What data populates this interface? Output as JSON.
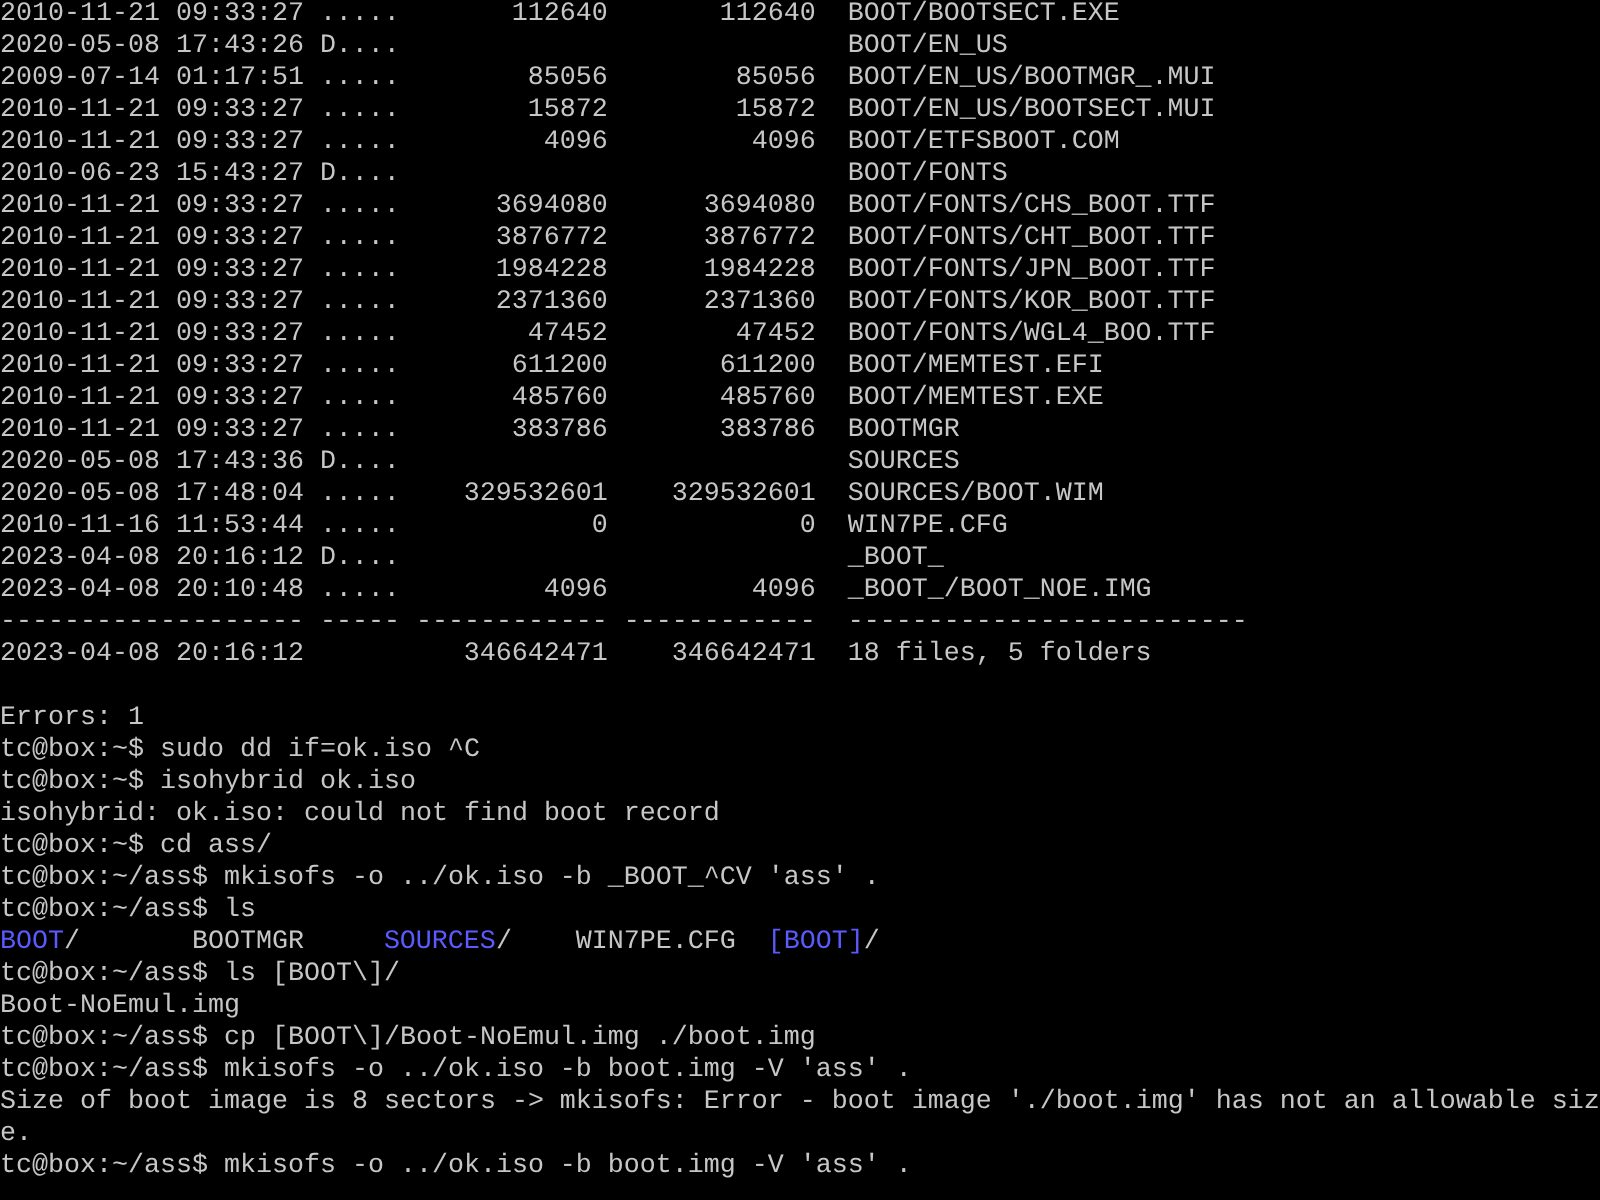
{
  "listing": {
    "rows": [
      {
        "date": "2010-11-21 09:33:27",
        "attr": ".....",
        "size": "112640",
        "stored": "112640",
        "name": "BOOT/BOOTSECT.EXE"
      },
      {
        "date": "2020-05-08 17:43:26",
        "attr": "D....",
        "name": "BOOT/EN_US"
      },
      {
        "date": "2009-07-14 01:17:51",
        "attr": ".....",
        "size": "85056",
        "stored": "85056",
        "name": "BOOT/EN_US/BOOTMGR_.MUI"
      },
      {
        "date": "2010-11-21 09:33:27",
        "attr": ".....",
        "size": "15872",
        "stored": "15872",
        "name": "BOOT/EN_US/BOOTSECT.MUI"
      },
      {
        "date": "2010-11-21 09:33:27",
        "attr": ".....",
        "size": "4096",
        "stored": "4096",
        "name": "BOOT/ETFSBOOT.COM"
      },
      {
        "date": "2010-06-23 15:43:27",
        "attr": "D....",
        "name": "BOOT/FONTS"
      },
      {
        "date": "2010-11-21 09:33:27",
        "attr": ".....",
        "size": "3694080",
        "stored": "3694080",
        "name": "BOOT/FONTS/CHS_BOOT.TTF"
      },
      {
        "date": "2010-11-21 09:33:27",
        "attr": ".....",
        "size": "3876772",
        "stored": "3876772",
        "name": "BOOT/FONTS/CHT_BOOT.TTF"
      },
      {
        "date": "2010-11-21 09:33:27",
        "attr": ".....",
        "size": "1984228",
        "stored": "1984228",
        "name": "BOOT/FONTS/JPN_BOOT.TTF"
      },
      {
        "date": "2010-11-21 09:33:27",
        "attr": ".....",
        "size": "2371360",
        "stored": "2371360",
        "name": "BOOT/FONTS/KOR_BOOT.TTF"
      },
      {
        "date": "2010-11-21 09:33:27",
        "attr": ".....",
        "size": "47452",
        "stored": "47452",
        "name": "BOOT/FONTS/WGL4_BOO.TTF"
      },
      {
        "date": "2010-11-21 09:33:27",
        "attr": ".....",
        "size": "611200",
        "stored": "611200",
        "name": "BOOT/MEMTEST.EFI"
      },
      {
        "date": "2010-11-21 09:33:27",
        "attr": ".....",
        "size": "485760",
        "stored": "485760",
        "name": "BOOT/MEMTEST.EXE"
      },
      {
        "date": "2010-11-21 09:33:27",
        "attr": ".....",
        "size": "383786",
        "stored": "383786",
        "name": "BOOTMGR"
      },
      {
        "date": "2020-05-08 17:43:36",
        "attr": "D....",
        "name": "SOURCES"
      },
      {
        "date": "2020-05-08 17:48:04",
        "attr": ".....",
        "size": "329532601",
        "stored": "329532601",
        "name": "SOURCES/BOOT.WIM"
      },
      {
        "date": "2010-11-16 11:53:44",
        "attr": ".....",
        "size": "0",
        "stored": "0",
        "name": "WIN7PE.CFG"
      },
      {
        "date": "2023-04-08 20:16:12",
        "attr": "D....",
        "name": "_BOOT_"
      },
      {
        "date": "2023-04-08 20:10:48",
        "attr": ".....",
        "size": "4096",
        "stored": "4096",
        "name": "_BOOT_/BOOT_NOE.IMG"
      }
    ],
    "separator": "------------------- ----- ------------ ------------  -------------------------",
    "total": {
      "date": "2023-04-08 20:16:12",
      "size": "346642471",
      "stored": "346642471",
      "name": "18 files, 5 folders"
    }
  },
  "console": [
    {
      "kind": "blank"
    },
    {
      "kind": "text",
      "text": "Errors: 1"
    },
    {
      "kind": "text",
      "text": "tc@box:~$ sudo dd if=ok.iso ^C"
    },
    {
      "kind": "text",
      "text": "tc@box:~$ isohybrid ok.iso"
    },
    {
      "kind": "text",
      "text": "isohybrid: ok.iso: could not find boot record"
    },
    {
      "kind": "text",
      "text": "tc@box:~$ cd ass/"
    },
    {
      "kind": "text",
      "text": "tc@box:~/ass$ mkisofs -o ../ok.iso -b _BOOT_^CV 'ass' ."
    },
    {
      "kind": "text",
      "text": "tc@box:~/ass$ ls"
    },
    {
      "kind": "ls",
      "items": [
        {
          "name": "BOOT",
          "suffix": "/",
          "kind": "dir"
        },
        {
          "name": "BOOTMGR",
          "kind": "file"
        },
        {
          "name": "SOURCES",
          "suffix": "/",
          "kind": "dir"
        },
        {
          "name": "WIN7PE.CFG",
          "kind": "file"
        },
        {
          "name": "[BOOT]",
          "suffix": "/",
          "kind": "dir"
        }
      ]
    },
    {
      "kind": "text",
      "text": "tc@box:~/ass$ ls [BOOT\\]/"
    },
    {
      "kind": "text",
      "text": "Boot-NoEmul.img"
    },
    {
      "kind": "text",
      "text": "tc@box:~/ass$ cp [BOOT\\]/Boot-NoEmul.img ./boot.img"
    },
    {
      "kind": "text",
      "text": "tc@box:~/ass$ mkisofs -o ../ok.iso -b boot.img -V 'ass' ."
    },
    {
      "kind": "text",
      "text": "Size of boot image is 8 sectors -> mkisofs: Error - boot image './boot.img' has not an allowable siz"
    },
    {
      "kind": "text",
      "text": "e."
    },
    {
      "kind": "text",
      "text": "tc@box:~/ass$ mkisofs -o ../ok.iso -b boot.img -V 'ass' ."
    }
  ]
}
